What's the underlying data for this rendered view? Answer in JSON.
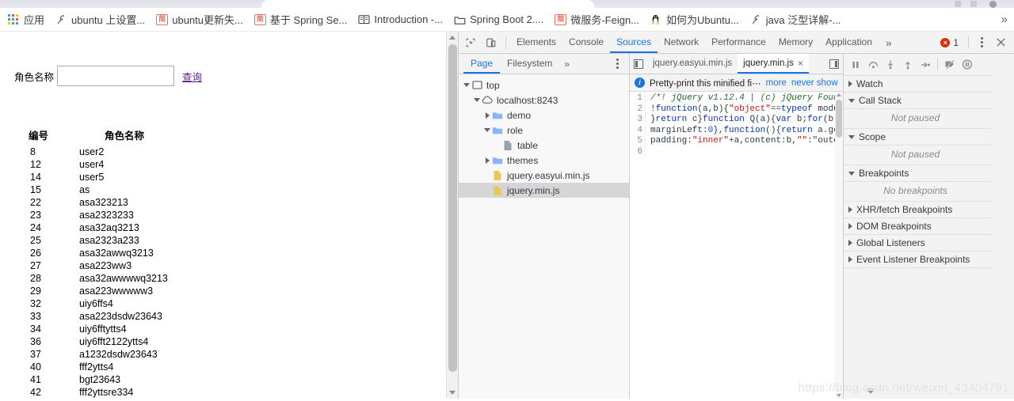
{
  "browser": {
    "bookmarks": [
      {
        "label": "应用",
        "icon": "apps-grid-icon"
      },
      {
        "label": "ubuntu 上设置...",
        "icon": "csdn-icon"
      },
      {
        "label": "ubuntu更新失...",
        "icon": "jianshu-icon"
      },
      {
        "label": "基于 Spring Se...",
        "icon": "jianshu-icon"
      },
      {
        "label": "Introduction -...",
        "icon": "book-icon"
      },
      {
        "label": "Spring Boot 2....",
        "icon": "folder-icon"
      },
      {
        "label": "微服务-Feign...",
        "icon": "jianshu-icon"
      },
      {
        "label": "如何为Ubuntu...",
        "icon": "penguin-icon"
      },
      {
        "label": "java 泛型详解-...",
        "icon": "csdn-icon"
      }
    ],
    "overflow_label": "»"
  },
  "page": {
    "form": {
      "label": "角色名称",
      "input_value": "",
      "input_placeholder": "",
      "query_link": "查询"
    },
    "table": {
      "headers": [
        "编号",
        "角色名称"
      ],
      "rows": [
        [
          "8",
          "user2"
        ],
        [
          "12",
          "user4"
        ],
        [
          "14",
          "user5"
        ],
        [
          "15",
          "as"
        ],
        [
          "22",
          "asa323213"
        ],
        [
          "23",
          "asa2323233"
        ],
        [
          "24",
          "asa32aq3213"
        ],
        [
          "25",
          "asa2323a233"
        ],
        [
          "26",
          "asa32awwq3213"
        ],
        [
          "27",
          "asa223ww3"
        ],
        [
          "28",
          "asa32awwwwq3213"
        ],
        [
          "29",
          "asa223wwwww3"
        ],
        [
          "32",
          "uiy6ffs4"
        ],
        [
          "33",
          "asa223dsdw23643"
        ],
        [
          "34",
          "uiy6fftytts4"
        ],
        [
          "36",
          "uiy6fft2122ytts4"
        ],
        [
          "37",
          "a1232dsdw23643"
        ],
        [
          "40",
          "fff2ytts4"
        ],
        [
          "41",
          "bgt23643"
        ],
        [
          "42",
          "fff2yttsre334"
        ]
      ]
    }
  },
  "devtools": {
    "toolbar": {
      "inspect_icon": "inspect-cursor-icon",
      "device_icon": "device-toolbar-icon",
      "tabs": [
        {
          "label": "Elements",
          "active": false
        },
        {
          "label": "Console",
          "active": false
        },
        {
          "label": "Sources",
          "active": true
        },
        {
          "label": "Network",
          "active": false
        },
        {
          "label": "Performance",
          "active": false
        },
        {
          "label": "Memory",
          "active": false
        },
        {
          "label": "Application",
          "active": false
        }
      ],
      "more_tabs": "»",
      "error_count": "1",
      "kebab_icon": "more-options-icon",
      "close_icon": "close-devtools-icon"
    },
    "navigator": {
      "tabs": [
        {
          "label": "Page",
          "active": true
        },
        {
          "label": "Filesystem",
          "active": false
        }
      ],
      "more": "»",
      "kebab_icon": "navigator-more-options-icon",
      "tree": [
        {
          "label": "top",
          "depth": 0,
          "icon": "frame-icon",
          "twist": "open",
          "selected": false
        },
        {
          "label": "localhost:8243",
          "depth": 1,
          "icon": "cloud-icon",
          "twist": "open",
          "selected": false
        },
        {
          "label": "demo",
          "depth": 2,
          "icon": "folder-icon",
          "twist": "closed",
          "selected": false
        },
        {
          "label": "role",
          "depth": 2,
          "icon": "folder-icon",
          "twist": "open",
          "selected": false
        },
        {
          "label": "table",
          "depth": 3,
          "icon": "document-icon",
          "twist": "none",
          "selected": false
        },
        {
          "label": "themes",
          "depth": 2,
          "icon": "folder-icon",
          "twist": "closed",
          "selected": false
        },
        {
          "label": "jquery.easyui.min.js",
          "depth": 2,
          "icon": "js-file-icon",
          "twist": "none",
          "selected": false
        },
        {
          "label": "jquery.min.js",
          "depth": 2,
          "icon": "js-file-icon",
          "twist": "none",
          "selected": true
        }
      ]
    },
    "editor": {
      "nav_prev_icon": "previous-tab-icon",
      "nav_next_icon": "next-tab-icon",
      "tabs": [
        {
          "label": "jquery.easyui.min.js",
          "active": false,
          "closable": false
        },
        {
          "label": "jquery.min.js",
          "active": true,
          "closable": true,
          "close_label": "×"
        }
      ],
      "infobar": {
        "icon": "info-icon",
        "icon_label": "i",
        "text": "Pretty-print this minified fi⋯",
        "more_link": "more",
        "never_show_link": "never show",
        "close_label": "×"
      },
      "line_numbers": [
        "1",
        "2",
        "3",
        "4",
        "5",
        "6"
      ],
      "code_lines": [
        "/*! jQuery v1.12.4 | (c) jQuery Foun",
        "!function(a,b){\"object\"==typeof modu",
        "}return c}function Q(a){var b;for(b",
        "marginLeft:0},function(){return a.ge",
        "padding:\"inner\"+a,content:b,\"\":\"oute",
        ""
      ]
    },
    "debugger": {
      "controls": [
        {
          "icon": "resume-pause-icon",
          "label": "Pause script execution"
        },
        {
          "icon": "step-over-icon",
          "label": "Step over next function call"
        },
        {
          "icon": "step-into-icon",
          "label": "Step into next function call"
        },
        {
          "icon": "step-out-icon",
          "label": "Step out of current function"
        },
        {
          "icon": "step-icon",
          "label": "Step"
        },
        {
          "icon": "deactivate-breakpoints-icon",
          "label": "Deactivate breakpoints"
        },
        {
          "icon": "pause-on-exceptions-icon",
          "label": "Pause on exceptions"
        }
      ],
      "sections": [
        {
          "title": "Watch",
          "state": "closed",
          "content": null
        },
        {
          "title": "Call Stack",
          "state": "open",
          "content": "Not paused"
        },
        {
          "title": "Scope",
          "state": "open",
          "content": "Not paused"
        },
        {
          "title": "Breakpoints",
          "state": "open",
          "content": "No breakpoints"
        },
        {
          "title": "XHR/fetch Breakpoints",
          "state": "closed",
          "content": null
        },
        {
          "title": "DOM Breakpoints",
          "state": "closed",
          "content": null
        },
        {
          "title": "Global Listeners",
          "state": "closed",
          "content": null
        },
        {
          "title": "Event Listener Breakpoints",
          "state": "closed",
          "content": null
        }
      ]
    }
  },
  "watermark": "https://blog.csdn.net/weixin_43404791",
  "colors": {
    "accent": "#1a73e8",
    "error": "#dd2c00",
    "jianshu": "#ea6f5a",
    "link_visited": "#551a8b",
    "folder": "#8ab4f8",
    "js_file": "#e8c65a"
  }
}
